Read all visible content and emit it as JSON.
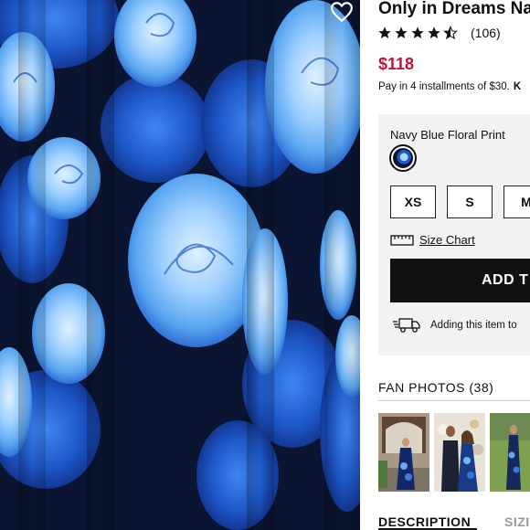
{
  "product": {
    "title": "Only in Dreams Na",
    "rating": 4.5,
    "review_count": "(106)",
    "price": "$118",
    "installments_text": "Pay in 4 installments of $30.",
    "installments_brand": "K",
    "color_label": "Navy Blue Floral Print",
    "sizes": [
      "XS",
      "S",
      "M"
    ],
    "size_chart_label": "Size Chart",
    "add_button_label": "ADD T",
    "shipping_text": "Adding this item to"
  },
  "fan_photos": {
    "title": "FAN PHOTOS (38)"
  },
  "tabs": {
    "description": "DESCRIPTION",
    "size": "SIZI"
  },
  "colors": {
    "price": "#c0143c",
    "fabric_navy": "#0b1430",
    "rose_blue": "#1e57c8",
    "rose_light": "#a9d6ff"
  },
  "icons": [
    "heart-icon",
    "star-icon",
    "ruler-icon",
    "truck-icon"
  ]
}
